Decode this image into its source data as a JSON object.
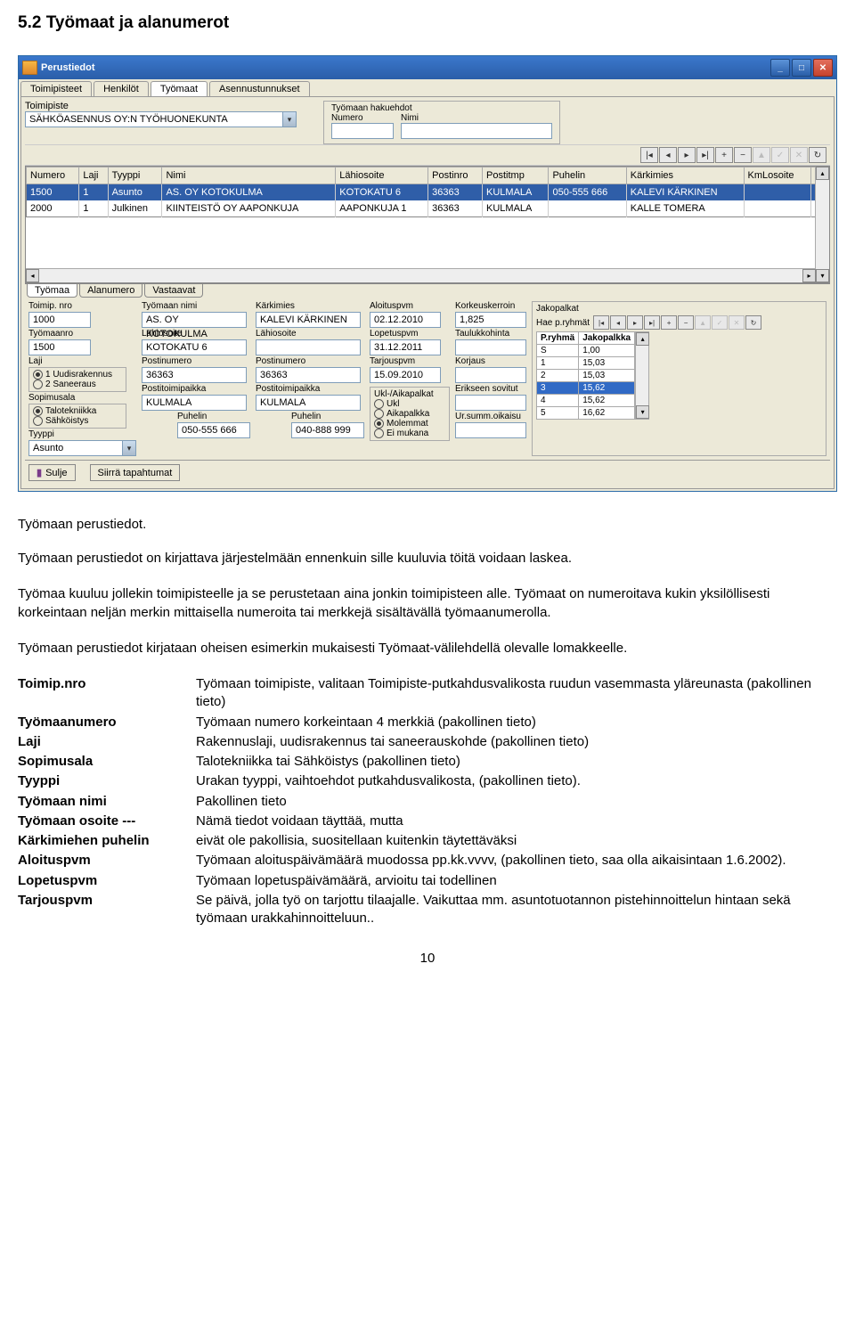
{
  "page": {
    "section_heading": "5.2    Työmaat ja alanumerot",
    "sub_heading": "Työmaan perustiedot.",
    "paragraphs": [
      "Työmaan perustiedot on kirjattava järjestelmään ennenkuin sille kuuluvia töitä voidaan laskea.",
      "Työmaa kuuluu jollekin toimipisteelle ja se perustetaan aina jonkin toimipisteen alle. Työmaat on numeroitava kukin yksilöllisesti korkeintaan neljän merkin mittaisella numeroita tai merkkejä sisältävällä työmaanumerolla.",
      "Työmaan perustiedot kirjataan oheisen esimerkin mukaisesti Työmaat-välilehdellä olevalle lomakkeelle."
    ],
    "number": "10"
  },
  "window": {
    "title": "Perustiedot",
    "tabs": [
      "Toimipisteet",
      "Henkilöt",
      "Työmaat",
      "Asennustunnukset"
    ],
    "active_tab": 2,
    "toimipiste_label": "Toimipiste",
    "toimipiste_value": "SÄHKÖASENNUS OY:N TYÖHUONEKUNTA",
    "haku_group": "Työmaan hakuehdot",
    "haku_numero": "Numero",
    "haku_nimi": "Nimi"
  },
  "grid": {
    "headers": [
      "Numero",
      "Laji",
      "Tyyppi",
      "Nimi",
      "Lähiosoite",
      "Postinro",
      "Postitmp",
      "Puhelin",
      "Kärkimies",
      "KmLosoite",
      "K"
    ],
    "rows": [
      [
        "1500",
        "1",
        "Asunto",
        "AS. OY KOTOKULMA",
        "KOTOKATU 6",
        "36363",
        "KULMALA",
        "050-555 666",
        "KALEVI KÄRKINEN",
        "",
        ""
      ],
      [
        "2000",
        "1",
        "Julkinen",
        "KIINTEISTÖ OY AAPONKUJA",
        "AAPONKUJA 1",
        "36363",
        "KULMALA",
        "",
        "KALLE TOMERA",
        "",
        ""
      ]
    ],
    "selected_row": 0
  },
  "bottom_tabs": {
    "items": [
      "Työmaa",
      "Alanumero",
      "Vastaavat"
    ],
    "active": 0
  },
  "form": {
    "left": {
      "toimipnro_label": "Toimip. nro",
      "toimipnro": "1000",
      "tyomaanimi_label": "Työmaan nimi",
      "tyomaanimi": "AS. OY KOTOKULMA",
      "tyomaanro_label": "Työmaanro",
      "tyomaanro": "1500",
      "lahiosoite_label": "Lähiosoite",
      "lahiosoite": "KOTOKATU 6",
      "laji_label": "Laji",
      "laji_opts": [
        "1 Uudisrakennus",
        "2 Saneeraus"
      ],
      "laji_selected": 0,
      "postinumero_label": "Postinumero",
      "postinumero": "36363",
      "sopimusala_label": "Sopimusala",
      "sopimusala_opts": [
        "Talotekniikka",
        "Sähköistys"
      ],
      "sopimusala_selected": 0,
      "postitoimipaikka_label": "Postitoimipaikka",
      "postitoimipaikka": "KULMALA",
      "puhelin_label": "Puhelin",
      "puhelin": "050-555 666",
      "tyyppi_label": "Tyyppi",
      "tyyppi": "Asunto"
    },
    "mid": {
      "karkimies_label": "Kärkimies",
      "karkimies": "KALEVI KÄRKINEN",
      "lahiosoite_label": "Lähiosoite",
      "lahiosoite": "",
      "postinumero_label": "Postinumero",
      "postinumero": "36363",
      "postitoimipaikka_label": "Postitoimipaikka",
      "postitoimipaikka": "KULMALA",
      "puhelin_label": "Puhelin",
      "puhelin": "040-888 999"
    },
    "right": {
      "aloituspvm_label": "Aloituspvm",
      "aloituspvm": "02.12.2010",
      "lopetuspvm_label": "Lopetuspvm",
      "lopetuspvm": "31.12.2011",
      "tarjouspvm_label": "Tarjouspvm",
      "tarjouspvm": "15.09.2010",
      "korkeuskerroin_label": "Korkeuskerroin",
      "korkeuskerroin": "1,825",
      "taulukkohinta_label": "Taulukkohinta",
      "taulukkohinta": "",
      "korjaus_label": "Korjaus",
      "korjaus": "",
      "ukl_group": "Ukl-/Aikapalkat",
      "ukl_opts": [
        "Ukl",
        "Aikapalkka",
        "Molemmat",
        "Ei mukana"
      ],
      "ukl_selected": 2,
      "erikseen_label": "Erikseen sovitut",
      "erikseen": "",
      "ursum_label": "Ur.summ.oikaisu",
      "ursum": ""
    }
  },
  "jako": {
    "group": "Jakopalkat",
    "haeryh_label": "Hae p.ryhmät",
    "headers": [
      "P.ryhmä",
      "Jakopalkka"
    ],
    "rows": [
      [
        "S",
        "1,00"
      ],
      [
        "1",
        "15,03"
      ],
      [
        "2",
        "15,03"
      ],
      [
        "3",
        "15,62"
      ],
      [
        "4",
        "15,62"
      ],
      [
        "5",
        "16,62"
      ]
    ],
    "selected": 3
  },
  "footer": {
    "sulje": "Sulje",
    "siirra": "Siirrä tapahtumat"
  },
  "definitions": [
    [
      "Toimip.nro",
      "Työmaan toimipiste, valitaan Toimipiste-putkahdusvalikosta ruudun vasemmasta yläreunasta (pakollinen tieto)"
    ],
    [
      "Työmaanumero",
      "Työmaan numero korkeintaan 4 merkkiä (pakollinen tieto)"
    ],
    [
      "Laji",
      "Rakennuslaji, uudisrakennus tai saneerauskohde (pakollinen tieto)"
    ],
    [
      "Sopimusala",
      "Talotekniikka tai Sähköistys (pakollinen tieto)"
    ],
    [
      "Tyyppi",
      "Urakan tyyppi, vaihtoehdot putkahdusvalikosta, (pakollinen tieto)."
    ],
    [
      "Työmaan nimi",
      "Pakollinen tieto"
    ],
    [
      "Työmaan osoite ---",
      "Nämä tiedot voidaan täyttää, mutta"
    ],
    [
      "Kärkimiehen puhelin",
      "eivät ole pakollisia, suositellaan kuitenkin täytettäväksi"
    ],
    [
      "Aloituspvm",
      "Työmaan aloituspäivämäärä muodossa pp.kk.vvvv, (pakollinen tieto, saa olla aikaisintaan 1.6.2002)."
    ],
    [
      "Lopetuspvm",
      "Työmaan lopetuspäivämäärä, arvioitu tai todellinen"
    ],
    [
      "Tarjouspvm",
      "Se päivä, jolla työ on tarjottu tilaajalle. Vaikuttaa mm. asuntotuotannon pistehinnoittelun hintaan sekä työmaan urakkahinnoitteluun.."
    ]
  ]
}
